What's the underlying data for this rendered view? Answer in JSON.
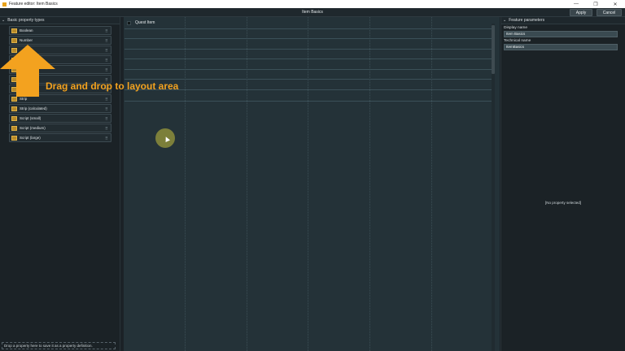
{
  "window": {
    "title": "Feature editor: Item Basics",
    "controls": [
      "—",
      "❐",
      "✕"
    ]
  },
  "header": {
    "title": "Item Basics",
    "apply_label": "Apply",
    "cancel_label": "Cancel"
  },
  "left_panel": {
    "section_title": "Basic property types",
    "items": [
      {
        "label": "Boolean"
      },
      {
        "label": "Number"
      },
      {
        "label": ""
      },
      {
        "label": ""
      },
      {
        "label": ""
      },
      {
        "label": ""
      },
      {
        "label": ""
      },
      {
        "label": "Strip"
      },
      {
        "label": "Strip (calculated)"
      },
      {
        "label": "Script (small)"
      },
      {
        "label": "Script (medium)"
      },
      {
        "label": "Script (large)"
      }
    ],
    "drop_hint": "Drop a property here to save it as a property definition."
  },
  "overlay": {
    "callout_text": "Drag and drop to layout area",
    "accent_color": "#f3a21f"
  },
  "layout_area": {
    "row_label": "Quest Item"
  },
  "right_panel": {
    "section_title": "Feature parameters",
    "display_name_label": "Display name",
    "display_name_value": "Item Basics",
    "technical_name_label": "Technical name",
    "technical_name_value": "ItemBasics",
    "empty_state": "[No property selected]"
  }
}
